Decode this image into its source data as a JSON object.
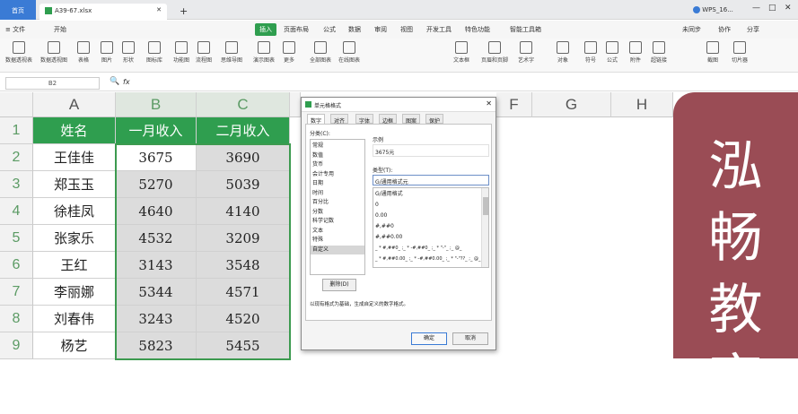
{
  "titlebar": {
    "home_tab": "首页",
    "file_tab": "A39-67.xlsx",
    "new_tab": "+",
    "right_label": "WPS_16..."
  },
  "menubar": {
    "items": [
      "≡ 文件",
      "开始",
      "插入",
      "页面布局",
      "公式",
      "数据",
      "审阅",
      "视图",
      "开发工具",
      "特色功能",
      "智能工具箱"
    ],
    "right_items": [
      "未同步",
      "协作",
      "分享"
    ]
  },
  "ribbon": {
    "buttons": [
      "数据透视表",
      "数据透视图",
      "表格",
      "图片",
      "形状",
      "图标库",
      "功能图",
      "流程图",
      "思维导图",
      "演示图表",
      "更多",
      "全部图表",
      "在线图表",
      "文本框",
      "页眉和页脚",
      "艺术字",
      "对象",
      "符号",
      "公式",
      "附件",
      "超链接",
      "截图",
      "切片器"
    ]
  },
  "formulabar": {
    "name_box": "B2",
    "fx_label": "fx",
    "value": "3675"
  },
  "sheet": {
    "columns": [
      "A",
      "B",
      "C",
      "D",
      "E",
      "F",
      "G",
      "H"
    ],
    "row_numbers": [
      "1",
      "2",
      "3",
      "4",
      "5",
      "6",
      "7",
      "8",
      "9"
    ],
    "header": [
      "姓名",
      "一月收入",
      "二月收入"
    ],
    "rows": [
      [
        "王佳佳",
        "3675",
        "3690"
      ],
      [
        "郑玉玉",
        "5270",
        "5039"
      ],
      [
        "徐桂凤",
        "4640",
        "4140"
      ],
      [
        "张家乐",
        "4532",
        "3209"
      ],
      [
        "王红",
        "3143",
        "3548"
      ],
      [
        "李丽娜",
        "5344",
        "4571"
      ],
      [
        "刘春伟",
        "3243",
        "4520"
      ],
      [
        "杨艺",
        "5823",
        "5455"
      ]
    ]
  },
  "dialog": {
    "title": "单元格格式",
    "tabs": [
      "数字",
      "对齐",
      "字体",
      "边框",
      "图案",
      "保护"
    ],
    "category_label": "分类(C):",
    "categories": [
      "常规",
      "数值",
      "货币",
      "会计专用",
      "日期",
      "时间",
      "百分比",
      "分数",
      "科学记数",
      "文本",
      "特殊",
      "自定义"
    ],
    "selected_category": "自定义",
    "sample_label": "示例",
    "sample_value": "3675元",
    "type_label": "类型(T):",
    "type_value": "G/通用格式元",
    "formats": [
      "G/通用格式",
      "0",
      "0.00",
      "#,##0",
      "#,##0.00",
      "_ * #,##0_ ;_ * -#,##0_ ;_ * \"-\"_ ;_ @_",
      "_ * #,##0.00_ ;_ * -#,##0.00_ ;_ * \"-\"??_ ;_ @_"
    ],
    "delete_button": "删除(D)",
    "description": "以现有格式为基础，生成自定义的数字格式。",
    "ok_button": "确定",
    "cancel_button": "取消"
  },
  "banner": {
    "chars": [
      "泓",
      "畅",
      "教",
      "育"
    ]
  }
}
